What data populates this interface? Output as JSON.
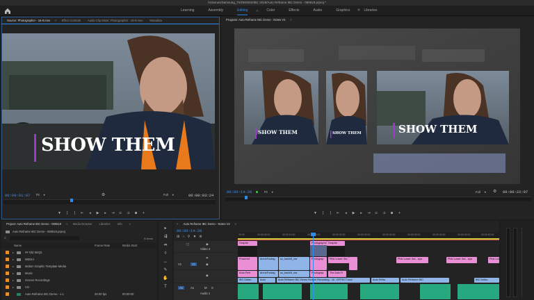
{
  "window": {
    "title": "/Volumes/Samsung_T5/DEMOS/IBC 2019/Auto Reframe IBC Demo - 090619.prproj *"
  },
  "workspaces": {
    "tabs": [
      "Learning",
      "Assembly",
      "Editing",
      "Color",
      "Effects",
      "Audio",
      "Graphics",
      "Libraries"
    ],
    "active": "Editing",
    "more": "»"
  },
  "source": {
    "tabs": [
      "Source: Photographer - 16-9.mov",
      "Effect Controls",
      "Audio Clip Mixer: Photographer - 16-9.mov",
      "Metadata"
    ],
    "menu_icon": "≡",
    "caption": "SHOW THEM",
    "timecode": "00:00:01:07",
    "fit": "Fit",
    "quality": "Full",
    "duration": "00:00:03:24"
  },
  "program": {
    "title": "Program: Auto Reframe IBC Demo - Notes V2",
    "menu_icon": "≡",
    "caption": "SHOW THEM",
    "timecode": "00:00:14:28",
    "fit": "Fit",
    "quality": "Full",
    "duration": "00:00:22:07"
  },
  "project": {
    "tabs": [
      "Project: Auto Reframe IBC Demo - 090619",
      "Media Browser",
      "Libraries",
      "Info"
    ],
    "more": "»",
    "bin_path": "Auto Reframe IBC Demo - 090619.prproj",
    "item_count": "9 Items",
    "columns": [
      "Name",
      "Frame Rate",
      "Media Start"
    ],
    "rows": [
      {
        "name": "## Old SEQs",
        "rate": "",
        "start": ""
      },
      {
        "name": "MEDIA",
        "rate": "",
        "start": ""
      },
      {
        "name": "Motion Graphic Template Media",
        "rate": "",
        "start": ""
      },
      {
        "name": "Music",
        "rate": "",
        "start": ""
      },
      {
        "name": "Screen Recordings",
        "rate": "",
        "start": ""
      },
      {
        "name": "VO",
        "rate": "",
        "start": ""
      },
      {
        "name": "Auto Reframe IBC Demo - 1.1",
        "rate": "30.00 fps",
        "start": "00:00:00"
      }
    ]
  },
  "timeline": {
    "tab": "Auto Reframe IBC Demo - Notes V2",
    "menu_icon": "≡",
    "timecode": "00:00:14:28",
    "ruler": [
      "00:00",
      "00:00:05:00",
      "00:00:10:00",
      "00:00:15:00",
      "00:00:20:00",
      "00:00:25:00",
      "00:00:30:00",
      "00:00:35:00",
      "00:00:40:00",
      "00:00:45:00",
      "00:00:50:00"
    ],
    "tracks": {
      "v4": "Video 4",
      "v1": "V1",
      "v1b": "V1",
      "a1": "A1",
      "a1b": "A1",
      "audio1": "Audio 1"
    },
    "clips": {
      "graphic": "Graphic",
      "photographer": "Photographe",
      "graphic2": "Graphic",
      "powered": "Powered",
      "droneFootage": "droneFootag",
      "scBacklit": "sc_backlit_ora",
      "photographer2": "Photograp",
      "lowerThird1": "Pink Lower 3rd - spa",
      "lowerThird2": "Pink Lower 3rd - spa",
      "lowerThird3": "Pink Lower 3rd - spa",
      "lowerThird4": "Pink Lower 3rd - sp",
      "autoReframe1": "Auto Refr",
      "droneFootage2": "droneFootag",
      "scBacklit2": "sc_backlit_ora",
      "photographer3": "Photograp",
      "theAuto": "The Auto R",
      "ibc1": "IBC Defau",
      "autoReframe2": "Auto",
      "screenRec": "Auto Reframe IBC Demo Screen Recording - 16 - EFFECT.mov",
      "autoReframe3": "Auto Refra",
      "autoReframe4": "Auto Reframe IBC",
      "ibc2": "IBC Defau"
    }
  },
  "colors": {
    "accent": "#2d8ceb",
    "label_pink": "#ea8fd6",
    "label_blue": "#8fb4e8",
    "audio_green": "#27a87e",
    "folder_orange": "#e8912b",
    "playhead": "#2d8ceb"
  }
}
